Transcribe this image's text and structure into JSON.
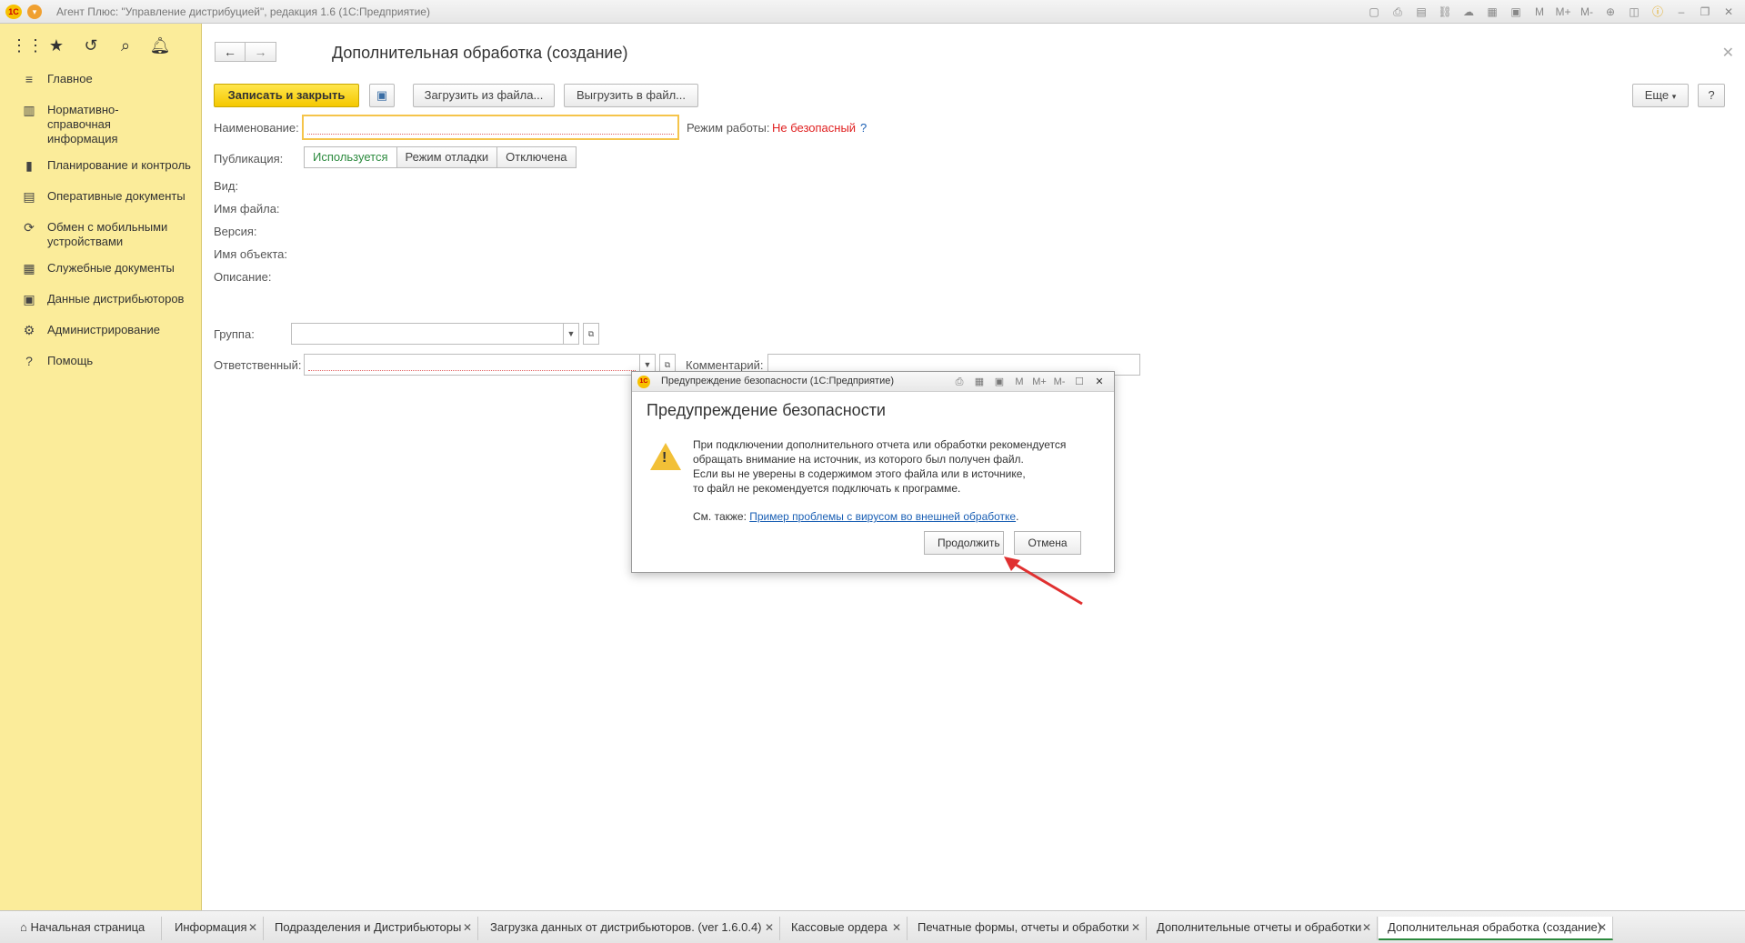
{
  "window": {
    "title": "Агент Плюс: \"Управление дистрибуцией\", редакция 1.6  (1С:Предприятие)"
  },
  "sidebar": {
    "items": [
      {
        "label": "Главное",
        "icon": "menu-lines-icon"
      },
      {
        "label": "Нормативно-справочная информация",
        "icon": "book-icon"
      },
      {
        "label": "Планирование и контроль",
        "icon": "bar-chart-icon"
      },
      {
        "label": "Оперативные документы",
        "icon": "document-icon"
      },
      {
        "label": "Обмен с мобильными устройствами",
        "icon": "sync-icon"
      },
      {
        "label": "Служебные документы",
        "icon": "documents-icon"
      },
      {
        "label": "Данные дистрибьюторов",
        "icon": "database-icon"
      },
      {
        "label": "Администрирование",
        "icon": "gear-icon"
      },
      {
        "label": "Помощь",
        "icon": "help-icon"
      }
    ]
  },
  "form": {
    "title": "Дополнительная обработка (создание)",
    "buttons": {
      "save_close": "Записать и закрыть",
      "load_file": "Загрузить из файла...",
      "export_file": "Выгрузить в файл...",
      "more": "Еще",
      "help": "?"
    },
    "fields": {
      "name_label": "Наименование:",
      "mode_label": "Режим работы:",
      "mode_value": "Не безопасный",
      "mode_help": "?",
      "publication_label": "Публикация:",
      "publication_options": [
        "Используется",
        "Режим отладки",
        "Отключена"
      ],
      "kind_label": "Вид:",
      "filename_label": "Имя файла:",
      "version_label": "Версия:",
      "object_label": "Имя объекта:",
      "description_label": "Описание:",
      "group_label": "Группа:",
      "responsible_label": "Ответственный:",
      "comment_label": "Комментарий:"
    }
  },
  "dialog": {
    "window_title": "Предупреждение безопасности  (1С:Предприятие)",
    "header": "Предупреждение безопасности",
    "message_lines": [
      "При подключении дополнительного отчета или обработки рекомендуется",
      "обращать внимание на источник, из которого был получен файл.",
      "Если вы не уверены в содержимом этого файла или в источнике,",
      "то файл не рекомендуется подключать к программе."
    ],
    "see_also_label": "См. также:",
    "see_also_link": "Пример проблемы с вирусом во внешней обработке",
    "see_also_end": ".",
    "continue_label": "Продолжить",
    "cancel_label": "Отмена"
  },
  "tabs": [
    {
      "label": "Начальная страница",
      "closable": false
    },
    {
      "label": "Информация",
      "closable": true
    },
    {
      "label": "Подразделения и Дистрибьюторы",
      "closable": true
    },
    {
      "label": "Загрузка данных от дистрибьюторов. (ver 1.6.0.4)",
      "closable": true
    },
    {
      "label": "Кассовые ордера",
      "closable": true
    },
    {
      "label": "Печатные формы, отчеты и обработки",
      "closable": true
    },
    {
      "label": "Дополнительные отчеты и обработки",
      "closable": true
    },
    {
      "label": "Дополнительная обработка (создание)",
      "closable": true,
      "active": true
    }
  ],
  "colors": {
    "sidebar_bg": "#fbec9a",
    "primary_button": "#f5c800",
    "warning_text": "#e02020",
    "link": "#1a5fb4",
    "active_tab_underline": "#2c8a3e"
  }
}
